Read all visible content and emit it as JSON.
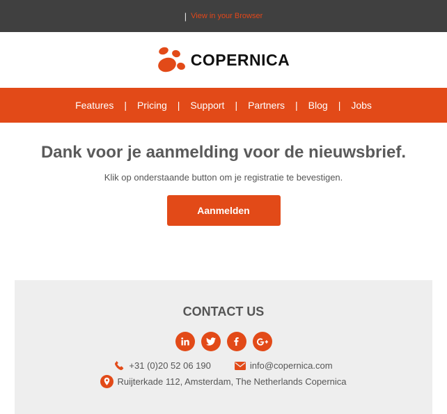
{
  "topbar": {
    "separator": "|",
    "view_link": "View in your Browser"
  },
  "brand": {
    "name": "COPERNICA",
    "accent": "#e24a18"
  },
  "nav": {
    "items": [
      "Features",
      "Pricing",
      "Support",
      "Partners",
      "Blog",
      "Jobs"
    ],
    "separator": "|"
  },
  "main": {
    "heading": "Dank voor je aanmelding voor de nieuwsbrief.",
    "subtext": "Klik op onderstaande button om je registratie te bevestigen.",
    "button_label": "Aanmelden"
  },
  "contact": {
    "title": "CONTACT US",
    "socials": [
      "linkedin-icon",
      "twitter-icon",
      "facebook-icon",
      "google-plus-icon"
    ],
    "phone": "+31 (0)20 52 06 190",
    "email": "info@copernica.com",
    "address": "Ruijterkade 112, Amsterdam, The Netherlands Copernica"
  }
}
